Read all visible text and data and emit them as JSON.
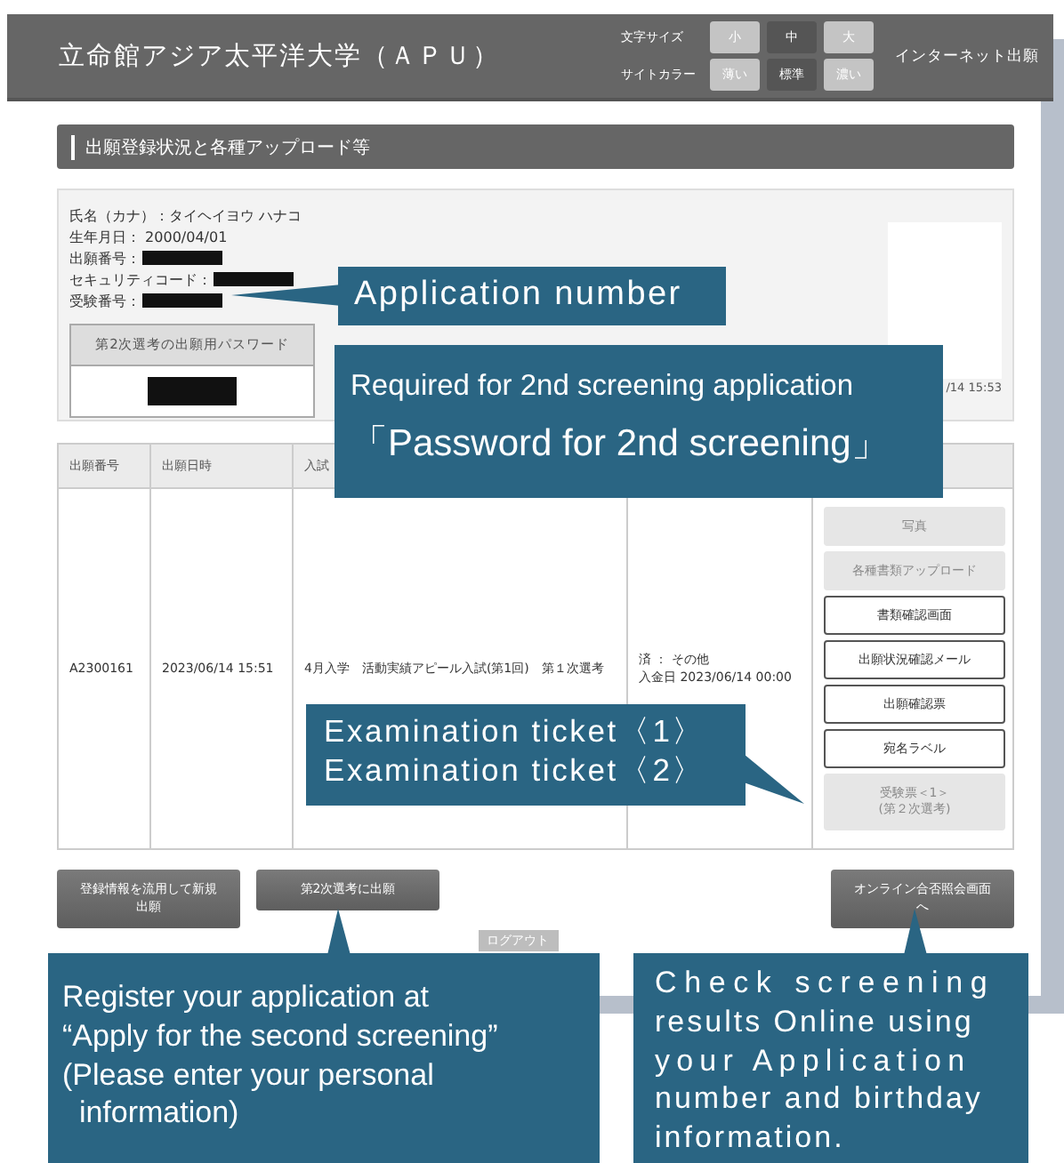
{
  "header": {
    "title": "立命館アジア太平洋大学（ＡＰＵ）",
    "font_size": {
      "label": "文字サイズ",
      "options": [
        {
          "label": "小",
          "selected": false
        },
        {
          "label": "中",
          "selected": true
        },
        {
          "label": "大",
          "selected": false
        }
      ]
    },
    "site_color": {
      "label": "サイトカラー",
      "options": [
        {
          "label": "薄い",
          "selected": false
        },
        {
          "label": "標準",
          "selected": true
        },
        {
          "label": "濃い",
          "selected": false
        }
      ]
    },
    "link": "インターネット出願"
  },
  "section_title": "出願登録状況と各種アップロード等",
  "profile": {
    "lines": [
      {
        "text": "氏名（カナ）：タイヘイヨウ ハナコ",
        "redacted": false
      },
      {
        "text": "生年月日： 2000/04/01",
        "redacted": false
      },
      {
        "text": "出願番号：",
        "redacted": true
      },
      {
        "text": "セキュリティコード：",
        "redacted": true
      },
      {
        "text": "受験番号：",
        "redacted": true
      }
    ],
    "password": {
      "title": "第2次選考の出願用パスワード",
      "redacted": true
    },
    "photo_caption": "/14 15:53"
  },
  "table": {
    "columns": [
      "出願番号",
      "出願日時",
      "入試"
    ],
    "rows": [
      {
        "cells": [
          "A2300161",
          "2023/06/14 15:51",
          "4月入学　活動実績アピール入試(第1回)　第１次選考"
        ],
        "status": [
          "済 ： その他",
          "入金日 2023/06/14 00:00"
        ],
        "actions": [
          {
            "label": "写真",
            "disabled": true
          },
          {
            "label": "各種書類アップロード",
            "disabled": true
          },
          {
            "label": "書類確認画面",
            "disabled": false
          },
          {
            "label": "出願状況確認メール",
            "disabled": false
          },
          {
            "label": "出願確認票",
            "disabled": false
          },
          {
            "label": "宛名ラベル",
            "disabled": false
          },
          {
            "label": "受験票＜1＞\n(第２次選考)",
            "disabled": true
          }
        ]
      }
    ]
  },
  "buttons": [
    {
      "label": "登録情報を流用して新規出願"
    },
    {
      "label": "第2次選考に出願"
    }
  ],
  "online_button": "オンライン合否照会画面へ",
  "logout": "ログアウト",
  "callouts": [
    {
      "lines": [
        "Application number"
      ]
    },
    {
      "lines": [
        "Required for 2nd screening application",
        "「Password for 2nd screening」"
      ]
    },
    {
      "lines": [
        "Examination ticket〈1〉",
        "Examination ticket〈2〉"
      ]
    },
    {
      "lines": [
        "Register your application at",
        "“Apply for the second screening”",
        "(Please enter your personal",
        "  information)"
      ]
    },
    {
      "lines": [
        "Check screening",
        "results Online using",
        "your Application",
        "number and birthday",
        "information."
      ]
    }
  ]
}
